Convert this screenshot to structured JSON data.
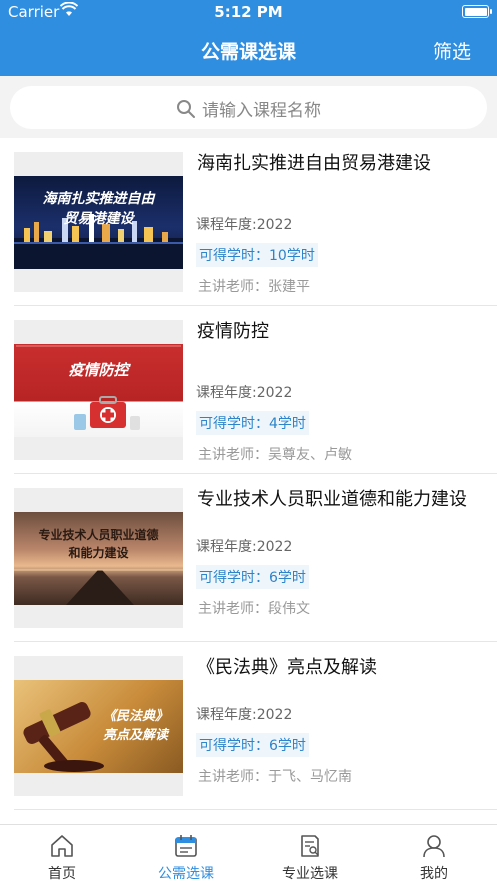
{
  "status": {
    "carrier": "Carrier",
    "time": "5:12 PM"
  },
  "nav": {
    "title": "公需课选课",
    "filter_label": "筛选"
  },
  "search": {
    "placeholder": "请输入课程名称"
  },
  "courses": [
    {
      "title": "海南扎实推进自由贸易港建设",
      "thumb_text": "海南扎实推进自由\n贸易港建设",
      "year": "课程年度:2022",
      "hours": "可得学时：10学时",
      "teacher": "主讲老师：张建平"
    },
    {
      "title": "疫情防控",
      "thumb_text": "疫情防控",
      "year": "课程年度:2022",
      "hours": "可得学时：4学时",
      "teacher": "主讲老师：吴尊友、卢敏"
    },
    {
      "title": "专业技术人员职业道德和能力建设",
      "thumb_text": "专业技术人员职业道德\n和能力建设",
      "year": "课程年度:2022",
      "hours": "可得学时：6学时",
      "teacher": "主讲老师：段伟文"
    },
    {
      "title": "《民法典》亮点及解读",
      "thumb_text": "《民法典》\n亮点及解读",
      "year": "课程年度:2022",
      "hours": "可得学时：6学时",
      "teacher": "主讲老师：于飞、马忆南"
    }
  ],
  "tabs": [
    {
      "label": "首页",
      "icon": "home-icon"
    },
    {
      "label": "公需选课",
      "icon": "calendar-icon"
    },
    {
      "label": "专业选课",
      "icon": "document-search-icon"
    },
    {
      "label": "我的",
      "icon": "person-icon"
    }
  ],
  "colors": {
    "primary": "#2f8ee0",
    "hours_text": "#2d84c9",
    "hours_bg": "#eef5fb",
    "muted": "#999999"
  }
}
